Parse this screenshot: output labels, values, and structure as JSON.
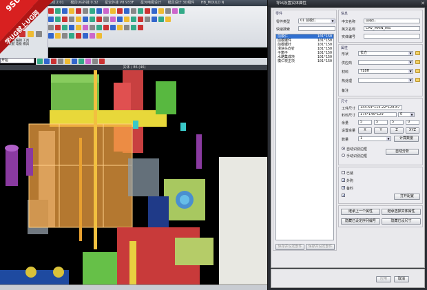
{
  "nx": {
    "title_segments": [
      "平板模具设计展线 2.01",
      "模具UG外挂 0.32",
      "星空外挂 V8.933F",
      "星河电极设计",
      "模具设计 3D组件",
      "HB_MOULD N"
    ],
    "left_labels": [
      "增强 录制 编辑 工具",
      "组件 装配 电极 模具"
    ],
    "layer_select": "开始",
    "view_bar": "实体 / 86 (46)"
  },
  "watermark": {
    "line1": "9SUG",
    "line2": "学UG就上UG网"
  },
  "dialog": {
    "title": "导出设置实体属性",
    "part_group_title": "零件",
    "part_type_label": "零件类型",
    "part_type_value": "01 前模仁",
    "quick_search_label": "快速搜索",
    "part_list": [
      {
        "name": "前模仁",
        "code": "101°150",
        "selected": true
      },
      {
        "name": "前模镶件",
        "code": "101°150",
        "selected": false
      },
      {
        "name": "前模镶针",
        "code": "101°150",
        "selected": false
      },
      {
        "name": "滑块头向针",
        "code": "101°150",
        "selected": false
      },
      {
        "name": "子箱子",
        "code": "101°150",
        "selected": false
      },
      {
        "name": "水路集成块",
        "code": "101°150",
        "selected": false
      },
      {
        "name": "模仁校正块",
        "code": "101°150",
        "selected": false
      }
    ],
    "info_group_title": "信息",
    "cn_name_label": "中文名称",
    "cn_name_value": "前模仁",
    "en_name_label": "英文名称",
    "en_name_value": "CAV_MAIN_INS",
    "part_no_label": "实体编号",
    "part_no_value": "",
    "attr_group_title": "属性",
    "shape_label": "形状",
    "shape_value": "长方",
    "supplier_label": "供应商",
    "supplier_value": "",
    "material_label": "材料",
    "material_value": "718H",
    "heat_label": "热处理",
    "heat_value": "",
    "remark_label": "备注",
    "size_group_title": "尺寸",
    "workpiece_size_label": "工件尺寸",
    "workpiece_size_value": "144.54*115.22*128.87",
    "stock_size_label": "料料尺寸",
    "stock_size_value": "175*145*129",
    "stock_size_num": "0",
    "allowance_label": "余量",
    "allowance_values": [
      "5",
      "5",
      "5",
      "0"
    ],
    "set_allowance_label": "设置余量",
    "axis_buttons": [
      "X",
      "Y",
      "Z",
      "XYZ"
    ],
    "quantity_label": "数量",
    "quantity_value": "1",
    "calc_qty_button": "计算数量",
    "radio_auto_label": "自动识别边框",
    "radio_manual_label": "手动识别边框",
    "auto_analyze_button": "自动分析",
    "check_title": "已装",
    "check_outsource": "外购",
    "check_stock": "备料",
    "check_hidden": "设置完隐藏实体",
    "open_config_button": "打开配置",
    "inherit_prev_button": "继承上一个属性",
    "inherit_sel_button": "继承选择实体属性",
    "hide_no_button": "隐藏已设定序列编号",
    "hide_size_button": "隐藏已设尺寸",
    "disabled_btn1": "保存并设定部件",
    "disabled_btn2": "保存并设定部件",
    "apply_button": "应用",
    "cancel_button": "取消"
  }
}
